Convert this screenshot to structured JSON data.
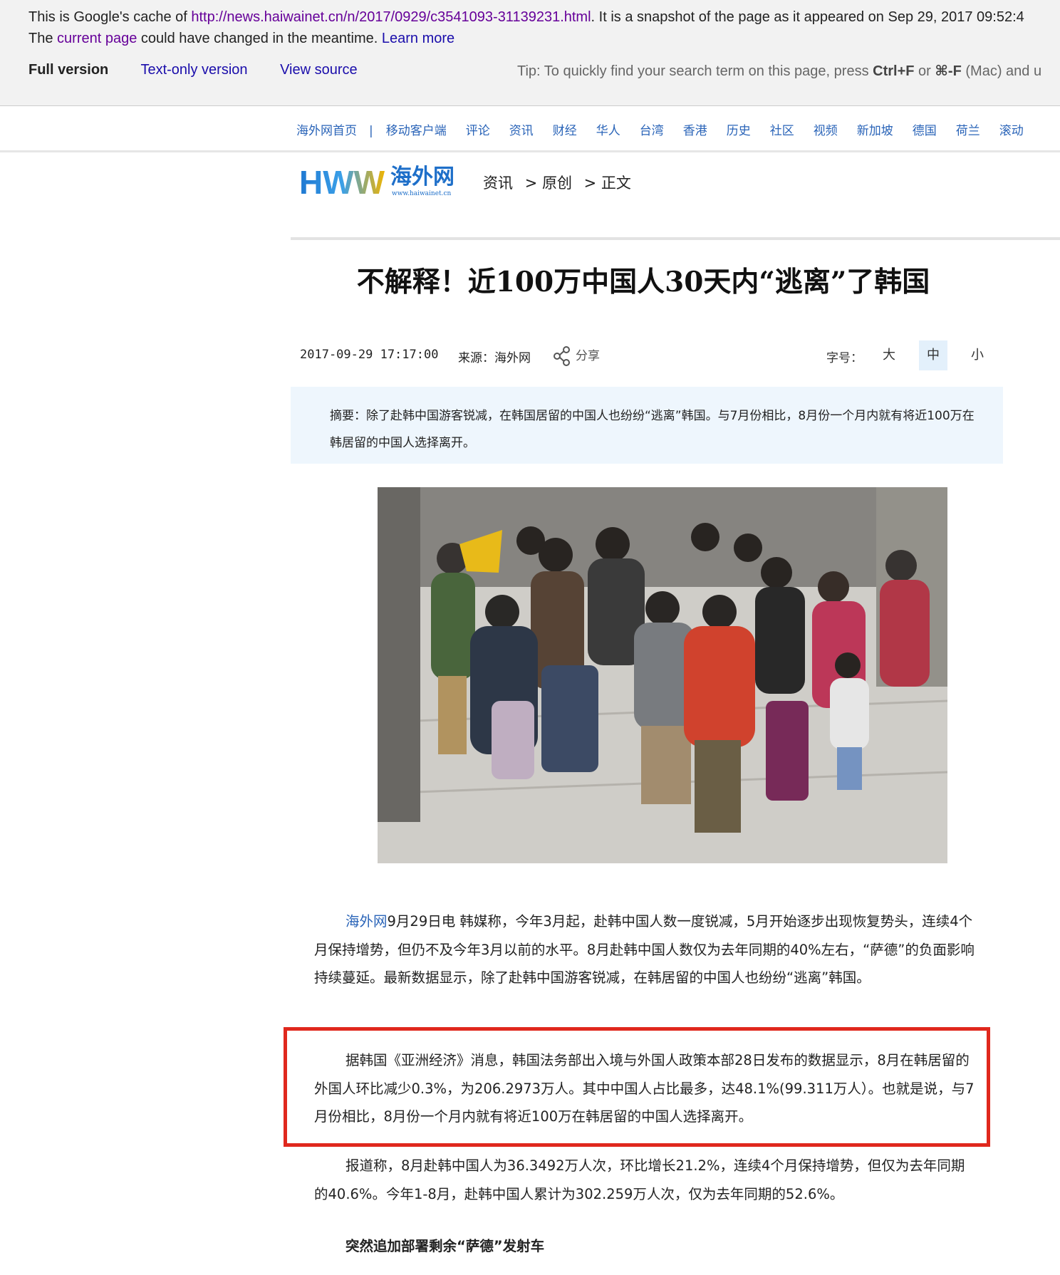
{
  "cache_header": {
    "line1_prefix": "This is Google's cache of ",
    "cached_url": "http://news.haiwainet.cn/n/2017/0929/c3541093-31139231.html",
    "line1_suffix": ". It is a snapshot of the page as it appeared on Sep 29, 2017 09:52:4",
    "line2_prefix": "The ",
    "current_page_link": "current page",
    "line2_middle": " could have changed in the meantime. ",
    "learn_more_link": "Learn more",
    "full_version": "Full version",
    "text_only_link": "Text-only version",
    "view_source_link": "View source",
    "tip_prefix": "Tip: To quickly find your search term on this page, press ",
    "tip_key1": "Ctrl+F",
    "tip_or": " or ",
    "tip_key2": "⌘-F",
    "tip_suffix": " (Mac) and u"
  },
  "site_nav": {
    "home": "海外网首页",
    "separator": "|",
    "items": [
      "移动客户端",
      "评论",
      "资讯",
      "财经",
      "华人",
      "台湾",
      "香港",
      "历史",
      "社区",
      "视频",
      "新加坡",
      "德国",
      "荷兰",
      "滚动"
    ]
  },
  "logo": {
    "letters": "HWW",
    "name": "海外网",
    "url_text": "www.haiwainet.cn"
  },
  "breadcrumb": {
    "level1": "资讯",
    "level2": "> 原创",
    "level3": "> 正文"
  },
  "article": {
    "title": "不解释！近100万中国人30天内“逃离”了韩国",
    "datetime": "2017-09-29 17:17:00",
    "source": "来源：海外网",
    "share_label": "分享",
    "font_size_label": "字号：",
    "font_sizes": [
      "大",
      "中",
      "小"
    ],
    "summary": "摘要：除了赴韩中国游客锐减，在韩国居留的中国人也纷纷“逃离”韩国。与7月份相比，8月份一个月内就有将近100万在韩居留的中国人选择离开。",
    "para1_link": "海外网",
    "para1_rest": "9月29日电  韩媒称，今年3月起，赴韩中国人数一度锐减，5月开始逐步出现恢复势头，连续4个月保持增势，但仍不及今年3月以前的水平。8月赴韩中国人数仅为去年同期的40%左右，“萨德”的负面影响持续蔓延。最新数据显示，除了赴韩中国游客锐减，在韩居留的中国人也纷纷“逃离”韩国。",
    "para2": "据韩国《亚洲经济》消息，韩国法务部出入境与外国人政策本部28日发布的数据显示，8月在韩居留的外国人环比减少0.3%，为206.2973万人。其中中国人占比最多，达48.1%(99.311万人）。也就是说，与7月份相比，8月份一个月内就有将近100万在韩居留的中国人选择离开。",
    "para3": "报道称，8月赴韩中国人为36.3492万人次，环比增长21.2%，连续4个月保持增势，但仅为去年同期的40.6%。今年1-8月，赴韩中国人累计为302.259万人次，仅为去年同期的52.6%。",
    "subheading": "突然追加部署剩余“萨德”发射车"
  },
  "colors": {
    "nav_blue": "#2a64b8",
    "highlight_red": "#e0281d",
    "summary_bg": "#eef6fd"
  }
}
